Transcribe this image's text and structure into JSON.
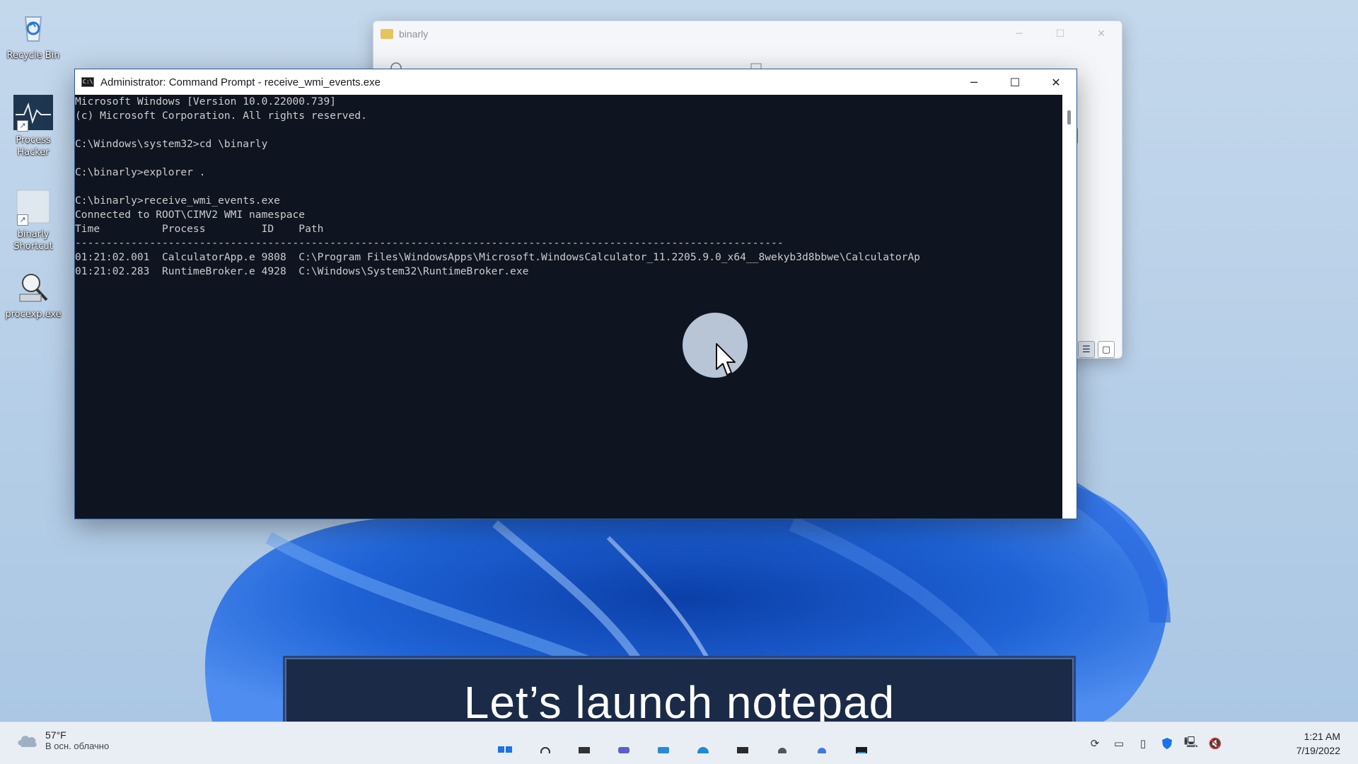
{
  "desktop": {
    "icons": [
      {
        "label": "Recycle Bin",
        "icon": "recycle-bin-icon"
      },
      {
        "label": "Process Hacker",
        "icon": "process-hacker-icon"
      },
      {
        "label": "binarly Shortcut",
        "icon": "folder-shortcut-icon"
      },
      {
        "label": "procexp.exe",
        "icon": "procexp-icon"
      }
    ]
  },
  "explorer": {
    "title": "binarly",
    "caption": {
      "minimize": "─",
      "maximize": "☐",
      "close": "✕"
    }
  },
  "cmd": {
    "title": "Administrator: Command Prompt - receive_wmi_events.exe",
    "caption": {
      "minimize": "─",
      "maximize": "☐",
      "close": "✕"
    },
    "lines": [
      "Microsoft Windows [Version 10.0.22000.739]",
      "(c) Microsoft Corporation. All rights reserved.",
      "",
      "C:\\Windows\\system32>cd \\binarly",
      "",
      "C:\\binarly>explorer .",
      "",
      "C:\\binarly>receive_wmi_events.exe",
      "Connected to ROOT\\CIMV2 WMI namespace",
      "Time          Process         ID    Path",
      "------------------------------------------------------------------------------------------------------------------",
      "01:21:02.001  CalculatorApp.e 9808  C:\\Program Files\\WindowsApps\\Microsoft.WindowsCalculator_11.2205.9.0_x64__8wekyb3d8bbwe\\CalculatorAp",
      "01:21:02.283  RuntimeBroker.e 4928  C:\\Windows\\System32\\RuntimeBroker.exe"
    ]
  },
  "caption_banner": {
    "text": "Let’s launch notepad"
  },
  "taskbar": {
    "weather": {
      "temp": "57°F",
      "desc": "В осн. облачно",
      "icon": "cloud-icon"
    },
    "apps": [
      "start-icon",
      "search-icon",
      "task-view-icon",
      "chat-icon",
      "widgets-icon",
      "edge-icon",
      "store-icon",
      "settings-icon",
      "app-icon",
      "terminal-icon"
    ],
    "tray": [
      "sync-icon",
      "display-icon",
      "usb-icon",
      "shield-icon",
      "network-icon",
      "volume-icon"
    ],
    "clock": {
      "time": "1:21 AM",
      "date": "7/19/2022"
    }
  },
  "colors": {
    "console_bg": "#0e1420",
    "console_fg": "#cccccc",
    "caption_bg": "#1b2a47",
    "wallpaper_bg": "#b3cde6",
    "bloom_blue": "#1d5fd0"
  }
}
